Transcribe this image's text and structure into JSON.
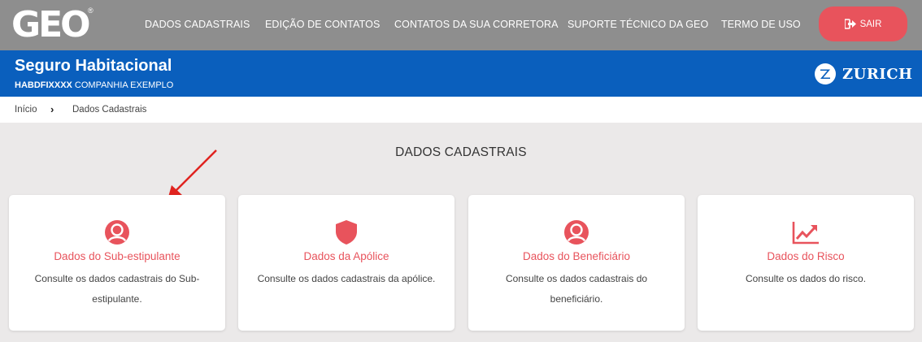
{
  "header": {
    "logo_text": "GEO",
    "logo_reg": "®",
    "nav": [
      {
        "label": "DADOS CADASTRAIS"
      },
      {
        "label": "EDIÇÃO DE CONTATOS"
      },
      {
        "label": "CONTATOS DA SUA CORRETORA"
      },
      {
        "label": "SUPORTE TÉCNICO DA GEO"
      },
      {
        "label": "TERMO DE USO"
      }
    ],
    "logout_label": "SAIR",
    "logout_icon": "sign-out-icon",
    "nav_color": "#8e8e8e",
    "accent_color": "#e8535c"
  },
  "policy_band": {
    "title": "Seguro Habitacional",
    "code": "HABDFIXXXX",
    "company": "COMPANHIA EXEMPLO",
    "insurer": "ZURICH",
    "band_color": "#0a5fbd"
  },
  "breadcrumb": {
    "home": "Início",
    "separator": "›",
    "current": "Dados Cadastrais"
  },
  "main": {
    "title": "DADOS CADASTRAIS",
    "cards": [
      {
        "icon": "user-circle-icon",
        "title": "Dados do Sub-estipulante",
        "description": "Consulte os dados cadastrais do Sub-estipulante."
      },
      {
        "icon": "shield-icon",
        "title": "Dados da Apólice",
        "description": "Consulte os dados cadastrais da apólice."
      },
      {
        "icon": "user-circle-icon",
        "title": "Dados do Beneficiário",
        "description": "Consulte os dados cadastrais do beneficiário."
      },
      {
        "icon": "trending-up-chart-icon",
        "title": "Dados do Risco",
        "description": "Consulte os dados do risco."
      }
    ]
  }
}
